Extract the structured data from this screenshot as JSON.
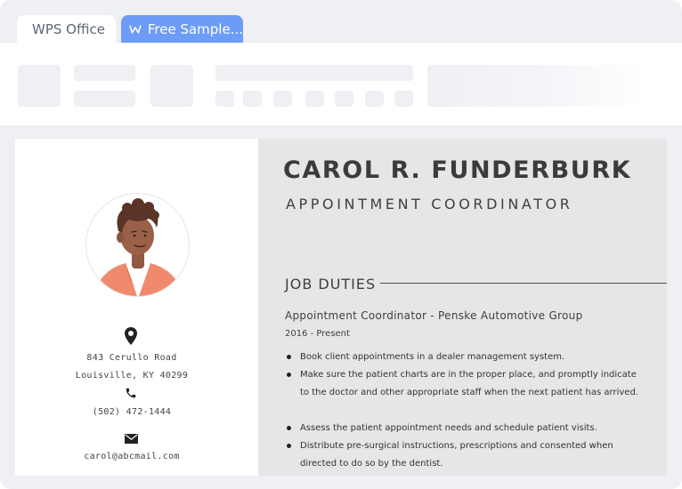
{
  "tabs": [
    {
      "label": "WPS Office"
    },
    {
      "label": "Free Sample..."
    }
  ],
  "icons": {
    "tab_logo": "wps-w-logo-icon",
    "location": "map-pin-icon",
    "phone": "phone-icon",
    "email": "envelope-icon"
  },
  "colors": {
    "accent_tab": "#6d9cf6",
    "resume_panel": "#e7e5e6",
    "avatar_shirt": "#f08a6c"
  },
  "resume": {
    "name": "CAROL R. FUNDERBURK",
    "title": "APPOINTMENT COORDINATOR",
    "contact": {
      "address_line1": "843 Cerullo Road",
      "address_line2": "Louisville, KY 40299",
      "phone": "(502) 472-1444",
      "email": "carol@abcmail.com"
    },
    "section_heading": "JOB DUTIES",
    "position": "Appointment Coordinator - Penske Automotive Group",
    "dates": "2016 - Present",
    "duties": [
      {
        "text": "Book client appointments in a dealer management system."
      },
      {
        "text": "Make sure the patient charts are in the proper place, and promptly indicate to the doctor and other appropriate staff when the next patient has arrived."
      },
      {
        "text": "Assess the patient appointment needs and schedule patient visits."
      },
      {
        "text": "Distribute pre-surgical instructions, prescriptions and consented when directed to do so by the dentist."
      }
    ]
  }
}
